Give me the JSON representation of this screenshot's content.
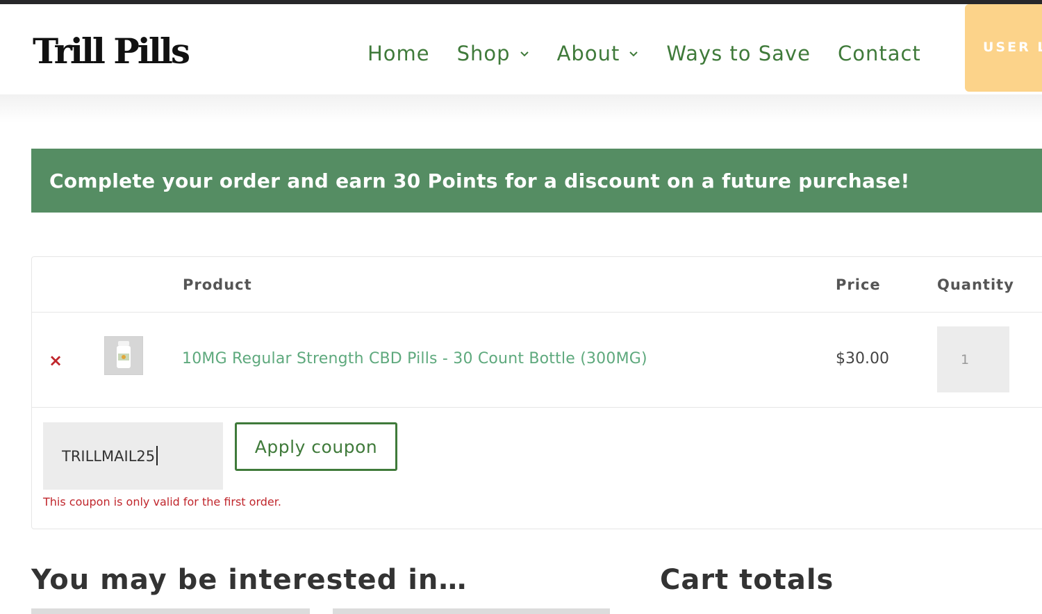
{
  "brand": {
    "logo_text": "Trill Pills"
  },
  "nav": {
    "items": [
      {
        "label": "Home",
        "has_dropdown": false
      },
      {
        "label": "Shop",
        "has_dropdown": true
      },
      {
        "label": "About",
        "has_dropdown": true
      },
      {
        "label": "Ways to Save",
        "has_dropdown": false
      },
      {
        "label": "Contact",
        "has_dropdown": false
      }
    ],
    "user_button_label": "USER L"
  },
  "notice": {
    "text": "Complete your order and earn 30 Points for a discount on a future purchase!"
  },
  "cart": {
    "headers": {
      "product": "Product",
      "price": "Price",
      "quantity": "Quantity"
    },
    "items": [
      {
        "remove_icon": "×",
        "image_alt": "product-bottle-thumbnail",
        "name": "10MG Regular Strength CBD Pills - 30 Count Bottle (300MG)",
        "price": "$30.00",
        "quantity": "1"
      }
    ],
    "coupon": {
      "value": "TRILLMAIL25",
      "apply_label": "Apply coupon",
      "error": "This coupon is only valid for the first order."
    }
  },
  "sections": {
    "interested_title": "You may be interested in…",
    "totals_title": "Cart totals"
  },
  "colors": {
    "nav_green": "#3f7a3a",
    "notice_bg": "#558d63",
    "link_green": "#5ea97d",
    "error_red": "#c0262c",
    "user_button_bg": "#fcd38a"
  }
}
